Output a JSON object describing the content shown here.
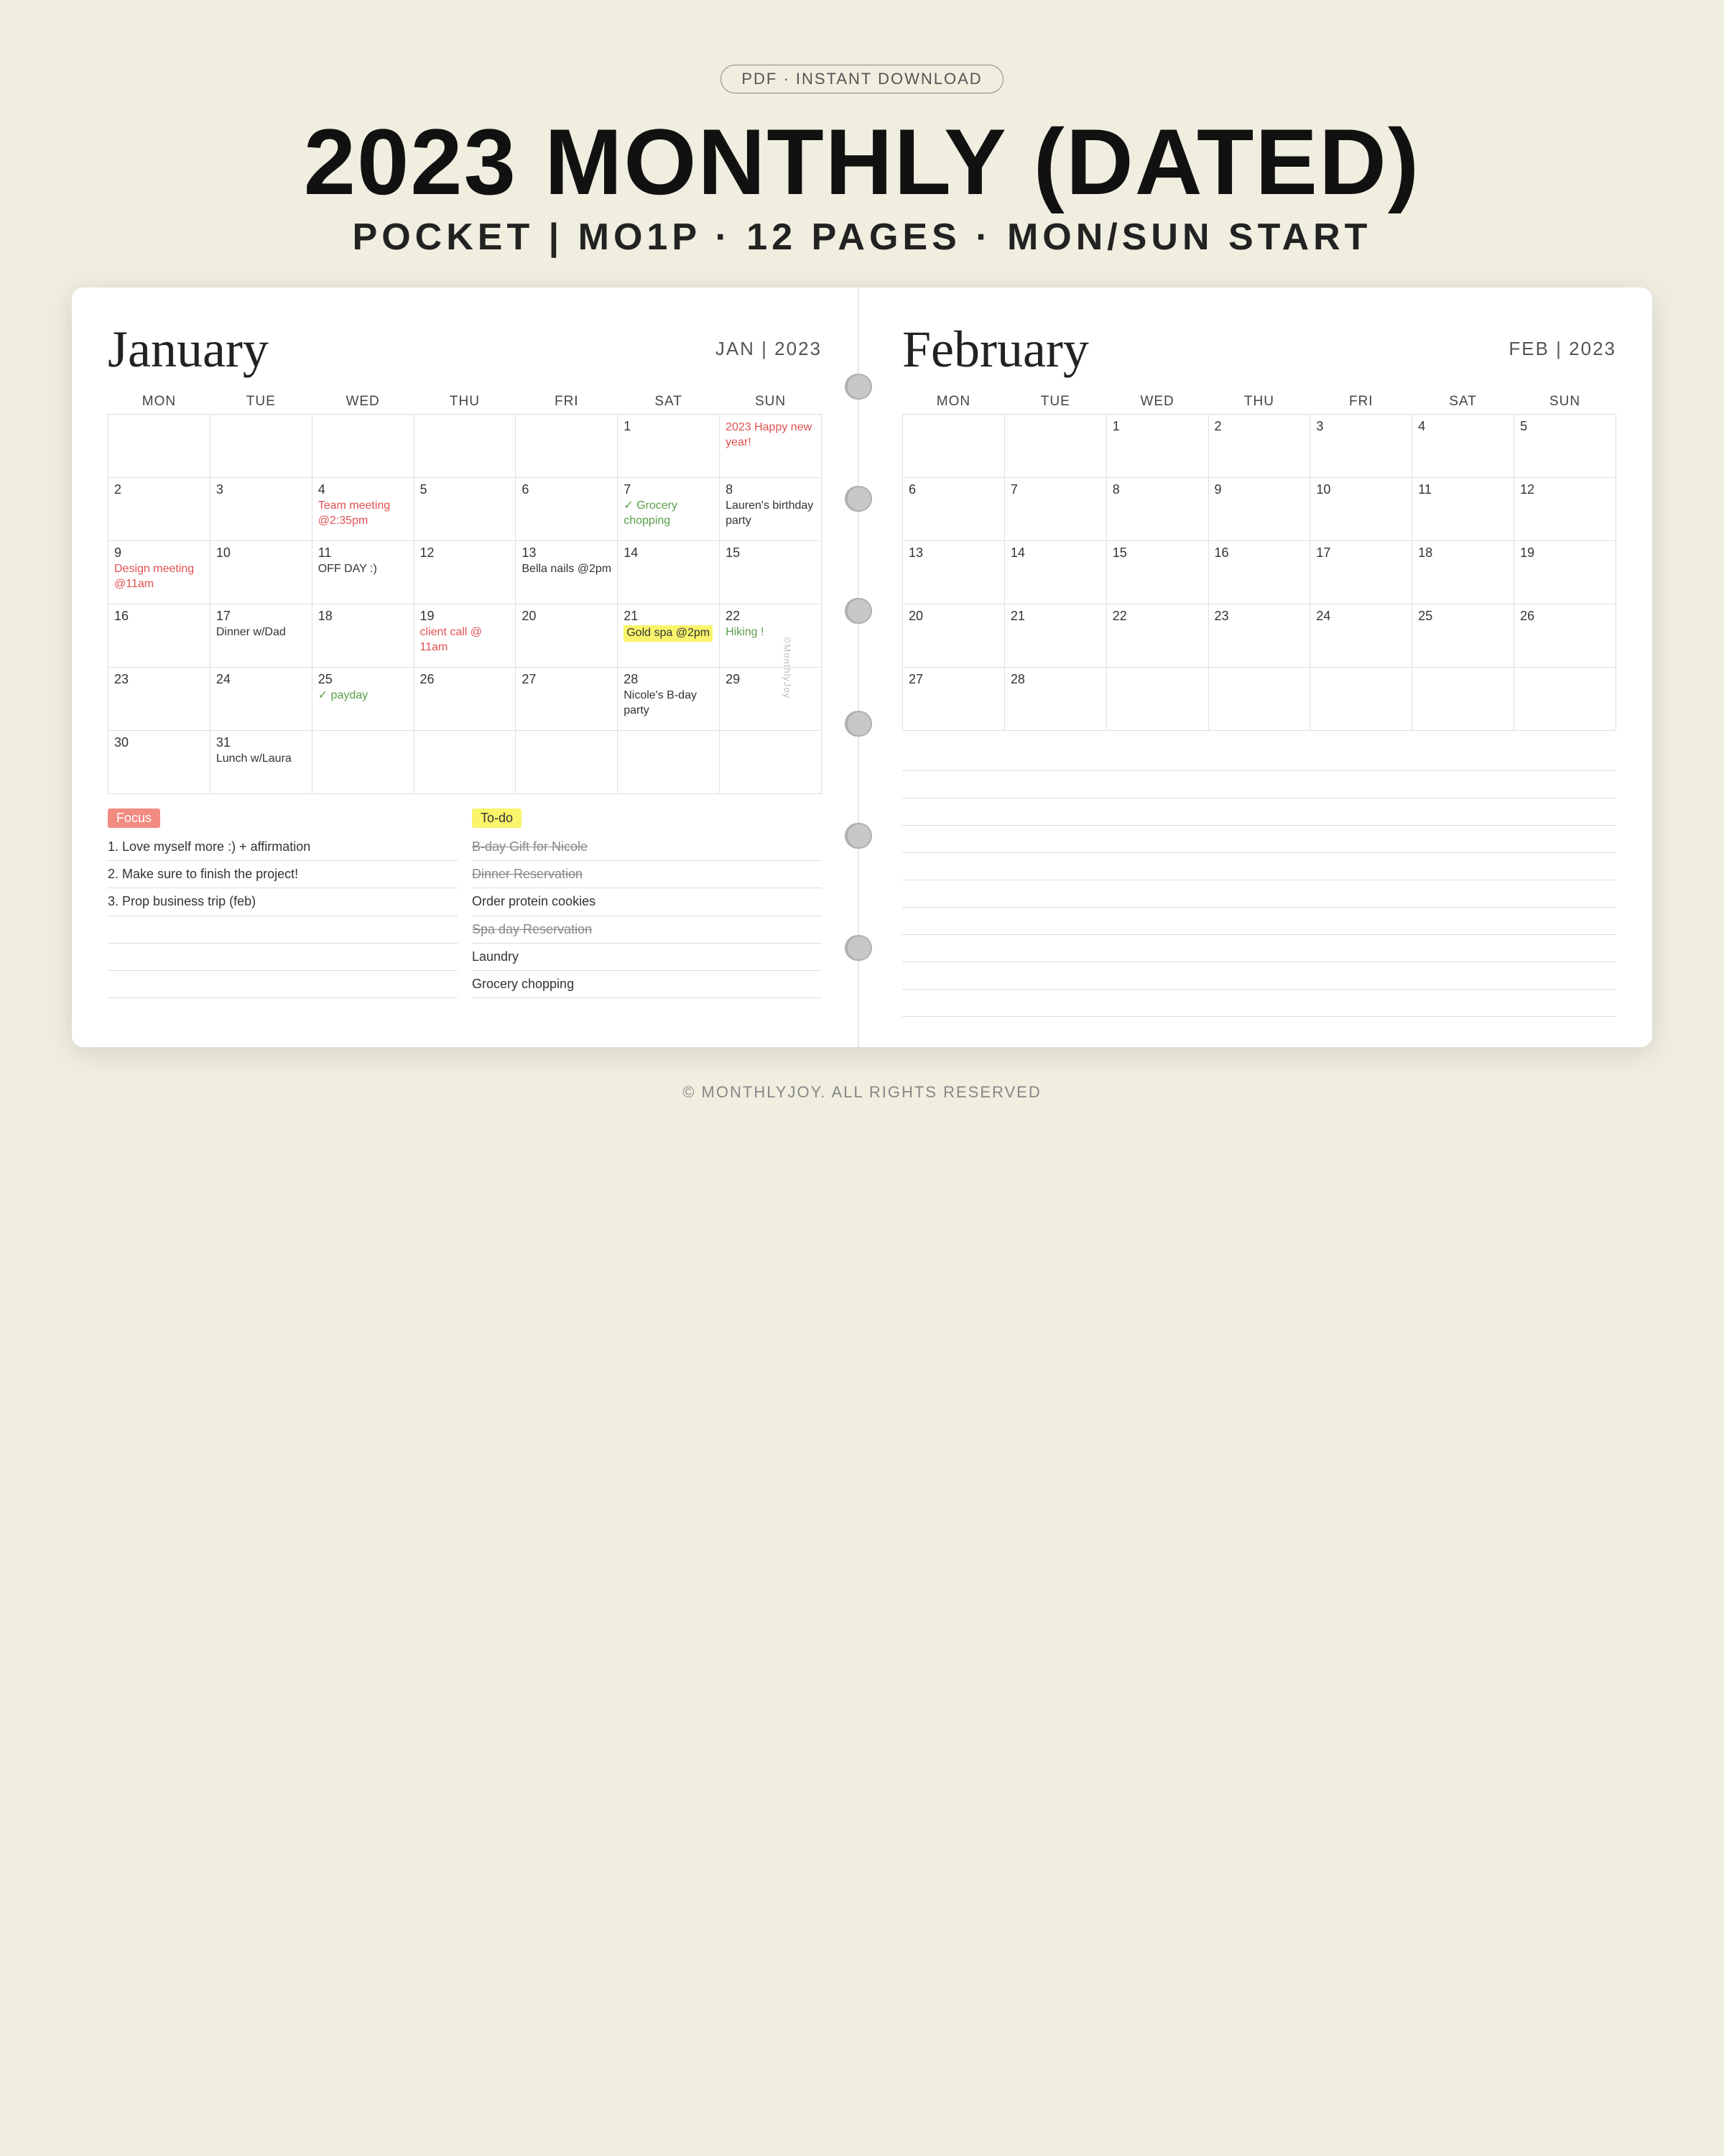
{
  "header": {
    "badge": "PDF · INSTANT DOWNLOAD",
    "title": "2023 MONTHLY (DATED)",
    "subtitle": "POCKET | MO1P · 12 PAGES · MON/SUN START"
  },
  "january": {
    "script_title": "January",
    "date_label": "JAN | 2023",
    "days_header": [
      "MON",
      "TUE",
      "WED",
      "THU",
      "FRI",
      "SAT",
      "SUN"
    ],
    "weeks": [
      [
        {
          "day": "",
          "events": []
        },
        {
          "day": "",
          "events": []
        },
        {
          "day": "",
          "events": []
        },
        {
          "day": "",
          "events": []
        },
        {
          "day": "",
          "events": []
        },
        {
          "day": "1",
          "events": []
        },
        {
          "day": "",
          "events": [
            {
              "text": "2023 Happy new year!",
              "style": "red"
            }
          ]
        }
      ],
      [
        {
          "day": "2",
          "events": []
        },
        {
          "day": "3",
          "events": []
        },
        {
          "day": "4",
          "events": [
            {
              "text": "Team meeting @2:35pm",
              "style": "red"
            }
          ]
        },
        {
          "day": "5",
          "events": []
        },
        {
          "day": "6",
          "events": []
        },
        {
          "day": "7",
          "events": [
            {
              "text": "✓ Grocery chopping",
              "style": "green"
            }
          ]
        },
        {
          "day": "8",
          "events": [
            {
              "text": "Lauren's birthday party",
              "style": "normal"
            }
          ]
        }
      ],
      [
        {
          "day": "9",
          "events": [
            {
              "text": "Design meeting @11am",
              "style": "red"
            }
          ]
        },
        {
          "day": "10",
          "events": []
        },
        {
          "day": "11",
          "events": [
            {
              "text": "OFF DAY :)",
              "style": "normal"
            }
          ]
        },
        {
          "day": "12",
          "events": []
        },
        {
          "day": "13",
          "events": [
            {
              "text": "Bella nails @2pm",
              "style": "normal"
            }
          ]
        },
        {
          "day": "14",
          "events": []
        },
        {
          "day": "15",
          "events": []
        }
      ],
      [
        {
          "day": "16",
          "events": []
        },
        {
          "day": "17",
          "events": [
            {
              "text": "Dinner w/Dad",
              "style": "normal"
            }
          ]
        },
        {
          "day": "18",
          "events": []
        },
        {
          "day": "19",
          "events": [
            {
              "text": "client call @ 11am",
              "style": "red"
            }
          ]
        },
        {
          "day": "20",
          "events": []
        },
        {
          "day": "21",
          "events": [
            {
              "text": "Gold spa @2pm",
              "style": "yellow-bg"
            }
          ]
        },
        {
          "day": "22",
          "events": [
            {
              "text": "Hiking !",
              "style": "green"
            }
          ]
        }
      ],
      [
        {
          "day": "23",
          "events": []
        },
        {
          "day": "24",
          "events": []
        },
        {
          "day": "25",
          "events": [
            {
              "text": "✓ payday",
              "style": "green"
            }
          ]
        },
        {
          "day": "26",
          "events": []
        },
        {
          "day": "27",
          "events": []
        },
        {
          "day": "28",
          "events": [
            {
              "text": "Nicole's B-day party",
              "style": "normal"
            }
          ]
        },
        {
          "day": "29",
          "events": []
        }
      ],
      [
        {
          "day": "30",
          "events": []
        },
        {
          "day": "31",
          "events": [
            {
              "text": "Lunch w/Laura",
              "style": "normal"
            }
          ]
        },
        {
          "day": "",
          "events": []
        },
        {
          "day": "",
          "events": []
        },
        {
          "day": "",
          "events": []
        },
        {
          "day": "",
          "events": []
        },
        {
          "day": "",
          "events": []
        }
      ]
    ],
    "focus_label": "Focus",
    "todo_label": "To-do",
    "focus_items": [
      "1. Love myself more :) + affirmation",
      "2. Make sure to finish the project!",
      "3. Prop business trip (feb)"
    ],
    "todo_items": [
      {
        "text": "B-day Gift for Nicole",
        "style": "strikethrough"
      },
      {
        "text": "Dinner Reservation",
        "style": "strikethrough"
      },
      {
        "text": "Order protein cookies",
        "style": "normal"
      },
      {
        "text": "Spa day Reservation",
        "style": "strikethrough"
      },
      {
        "text": "Laundry",
        "style": "normal"
      },
      {
        "text": "Grocery chopping",
        "style": "normal"
      }
    ]
  },
  "february": {
    "script_title": "February",
    "date_label": "FEB | 2023",
    "days_header": [
      "MON",
      "TUE",
      "WED",
      "THU",
      "FRI",
      "SAT",
      "SUN"
    ],
    "weeks": [
      [
        {
          "day": "",
          "events": []
        },
        {
          "day": "",
          "events": []
        },
        {
          "day": "1",
          "events": []
        },
        {
          "day": "2",
          "events": []
        },
        {
          "day": "3",
          "events": []
        },
        {
          "day": "4",
          "events": []
        },
        {
          "day": "5",
          "events": []
        }
      ],
      [
        {
          "day": "6",
          "events": []
        },
        {
          "day": "7",
          "events": []
        },
        {
          "day": "8",
          "events": []
        },
        {
          "day": "9",
          "events": []
        },
        {
          "day": "10",
          "events": []
        },
        {
          "day": "11",
          "events": []
        },
        {
          "day": "12",
          "events": []
        }
      ],
      [
        {
          "day": "13",
          "events": []
        },
        {
          "day": "14",
          "events": []
        },
        {
          "day": "15",
          "events": []
        },
        {
          "day": "16",
          "events": []
        },
        {
          "day": "17",
          "events": []
        },
        {
          "day": "18",
          "events": []
        },
        {
          "day": "19",
          "events": []
        }
      ],
      [
        {
          "day": "20",
          "events": []
        },
        {
          "day": "21",
          "events": []
        },
        {
          "day": "22",
          "events": []
        },
        {
          "day": "23",
          "events": []
        },
        {
          "day": "24",
          "events": []
        },
        {
          "day": "25",
          "events": []
        },
        {
          "day": "26",
          "events": []
        }
      ],
      [
        {
          "day": "27",
          "events": []
        },
        {
          "day": "28",
          "events": []
        },
        {
          "day": "",
          "events": []
        },
        {
          "day": "",
          "events": []
        },
        {
          "day": "",
          "events": []
        },
        {
          "day": "",
          "events": []
        },
        {
          "day": "",
          "events": []
        }
      ]
    ]
  },
  "copyright": "© MONTHLYJOY. ALL RIGHTS RESERVED"
}
